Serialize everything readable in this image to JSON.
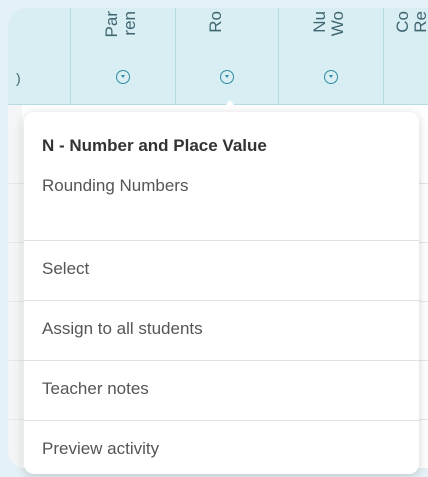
{
  "columns": [
    {
      "line1": "Par",
      "line2": "ren"
    },
    {
      "line1": "Ro",
      "line2": ""
    },
    {
      "line1": "Nu",
      "line2": "Wo"
    },
    {
      "line1": "Co",
      "line2": "Re"
    }
  ],
  "left_stub_text": ")",
  "popup": {
    "title": "N - Number and Place Value",
    "subtitle": "Rounding Numbers",
    "menu": [
      {
        "label": "Select"
      },
      {
        "label": "Assign to all students"
      },
      {
        "label": "Teacher notes"
      },
      {
        "label": "Preview activity"
      }
    ]
  },
  "colors": {
    "header_bg": "#d9eef3",
    "accent": "#2f8aa2",
    "background": "#e4f1f6"
  }
}
